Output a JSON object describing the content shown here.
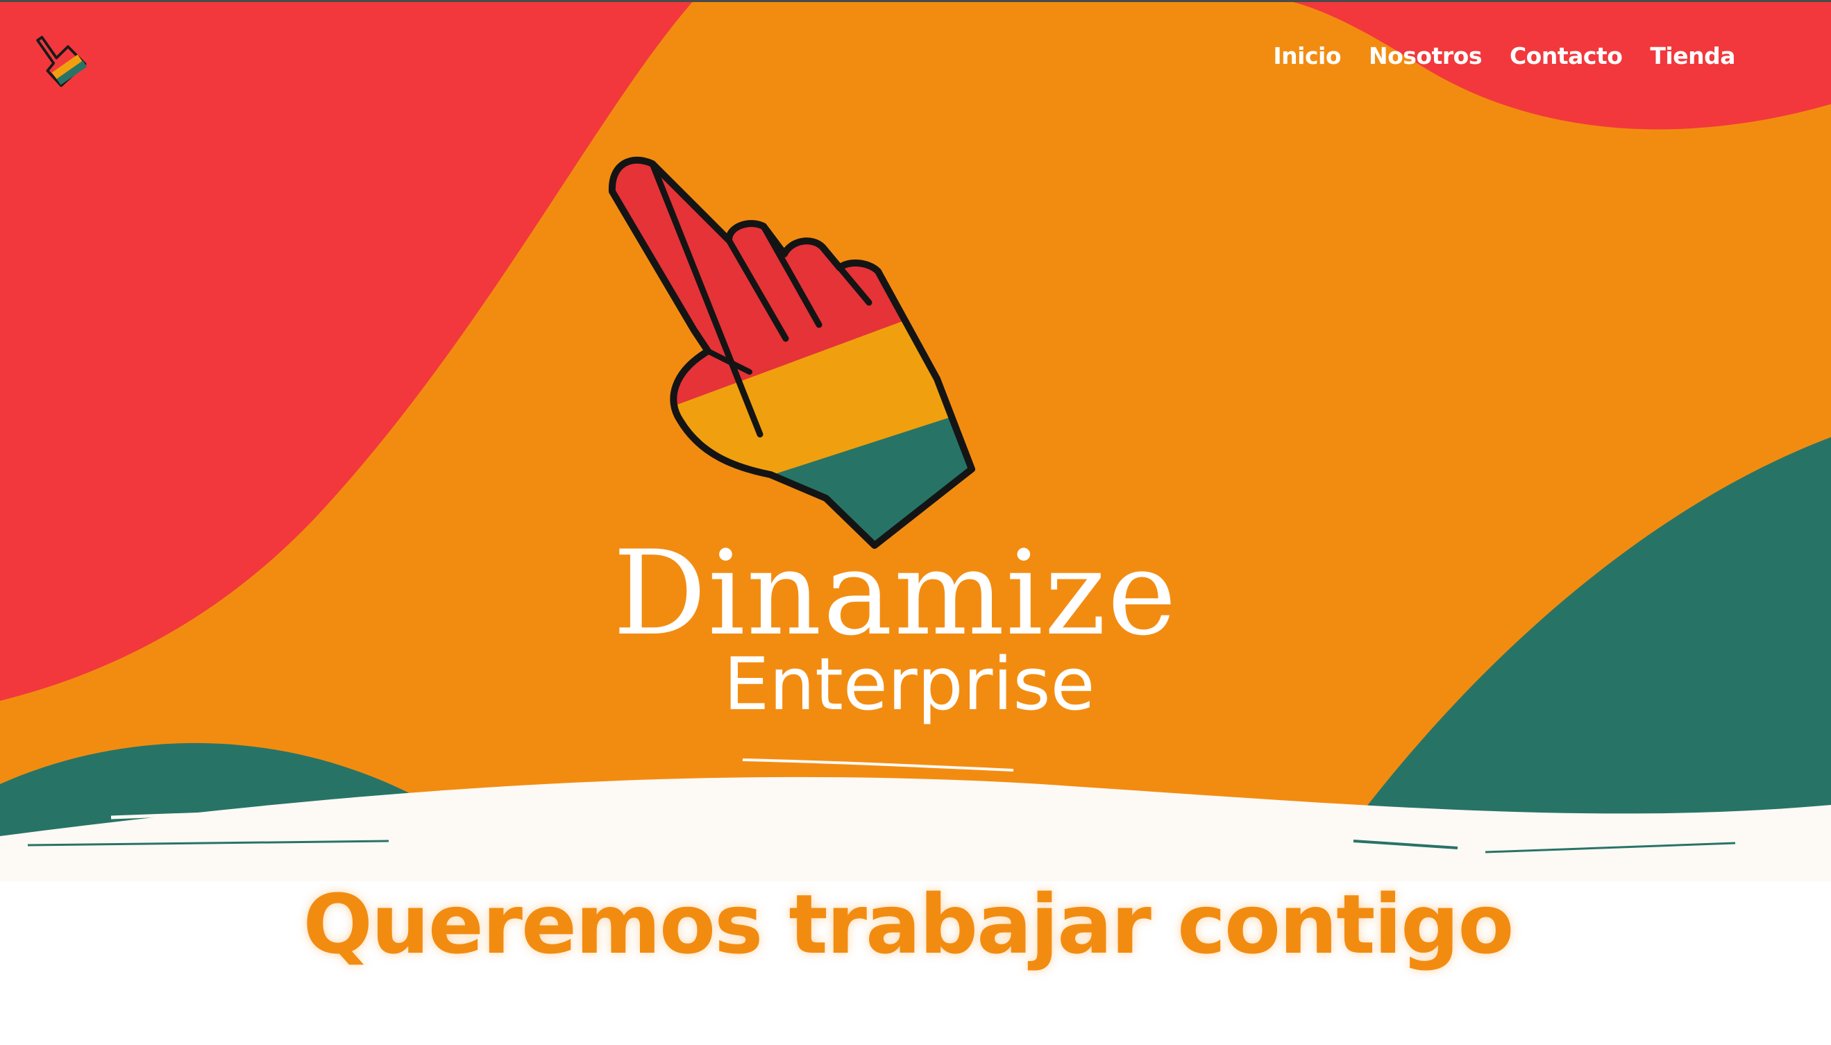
{
  "nav": {
    "items": [
      {
        "label": "Inicio"
      },
      {
        "label": "Nosotros"
      },
      {
        "label": "Contacto"
      },
      {
        "label": "Tienda"
      }
    ],
    "logo_icon": "pointing-hand-icon"
  },
  "hero": {
    "brand_name": "Dinamize",
    "brand_sub": "Enterprise",
    "hand_icon": "pointing-hand-icon",
    "colors": {
      "red": "#f2383c",
      "orange": "#f28c11",
      "teal": "#277466",
      "yellow": "#f0a00e",
      "white": "#ffffff"
    }
  },
  "main": {
    "tagline": "Queremos trabajar contigo"
  }
}
